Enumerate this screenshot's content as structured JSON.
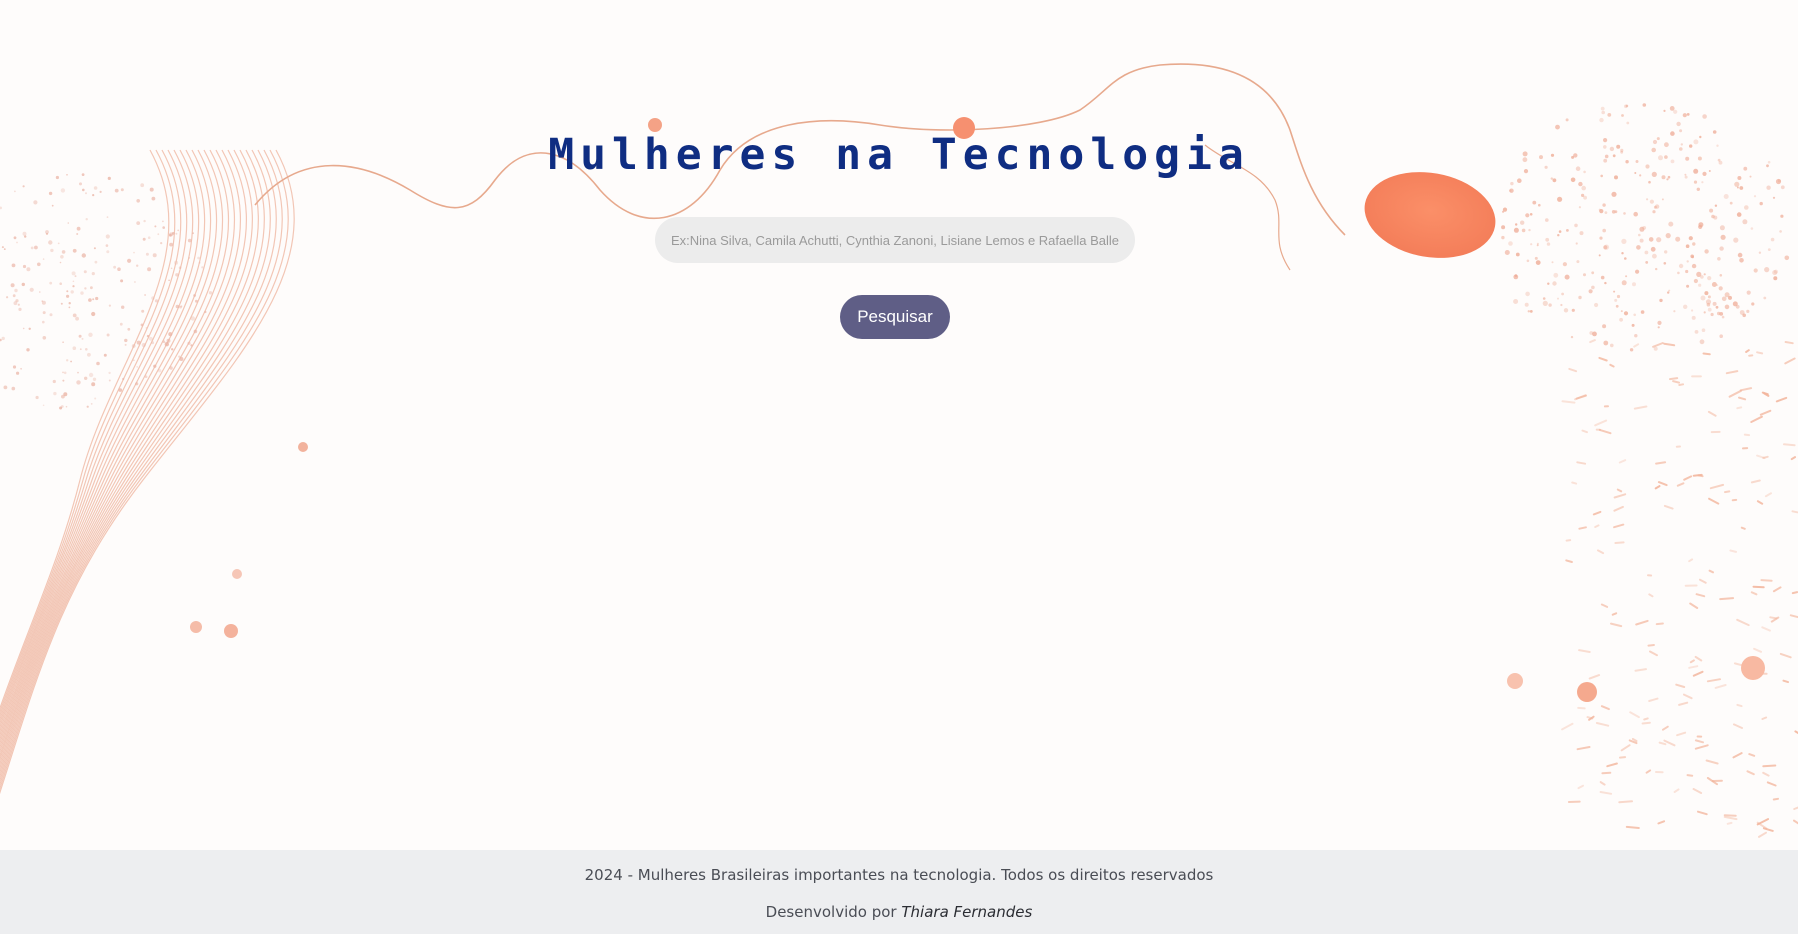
{
  "header": {
    "title": "Mulheres na Tecnologia"
  },
  "search": {
    "placeholder": "Ex:Nina Silva, Camila Achutti, Cynthia Zanoni, Lisiane Lemos e Rafaella Ballerine",
    "value": "",
    "button_label": "Pesquisar"
  },
  "footer": {
    "copyright": "2024 - Mulheres Brasileiras importantes na tecnologia. Todos os direitos reservados",
    "developed_by_prefix": "Desenvolvido por",
    "developer_name": "Thiara Fernandes"
  },
  "colors": {
    "title": "#0f2d82",
    "button": "#5f5e86",
    "accent": "#f88a66",
    "input_bg": "#ececec",
    "footer_bg": "#edeef0"
  },
  "decor": {
    "background": "abstract-orange-dotted-waves"
  }
}
